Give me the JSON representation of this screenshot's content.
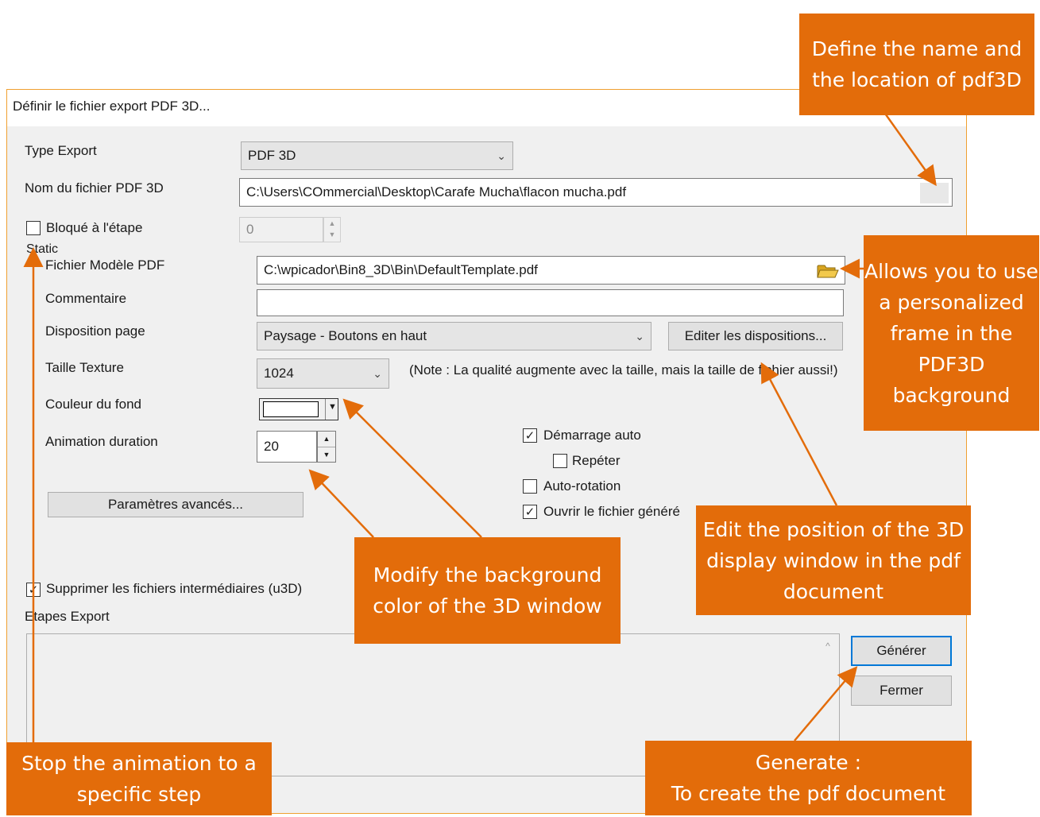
{
  "window": {
    "title": "Définir le fichier export PDF 3D..."
  },
  "form": {
    "type_export_label": "Type Export",
    "type_export_value": "PDF 3D",
    "nom_fichier_label": "Nom du fichier PDF 3D",
    "nom_fichier_value": "C:\\Users\\COmmercial\\Desktop\\Carafe Mucha\\flacon mucha.pdf",
    "bloque_label": "Bloqué à l'étape",
    "bloque_checked": false,
    "bloque_value": "0",
    "static_label": "Static",
    "modele_label": "Fichier Modèle PDF",
    "modele_value": "C:\\wpicador\\Bin8_3D\\Bin\\DefaultTemplate.pdf",
    "commentaire_label": "Commentaire",
    "commentaire_value": "",
    "disposition_label": "Disposition page",
    "disposition_value": "Paysage - Boutons en haut",
    "editer_button": "Editer les dispositions...",
    "texture_label": "Taille Texture",
    "texture_value": "1024",
    "texture_note": "(Note : La qualité augmente avec la taille, mais la taille de fichier aussi!)",
    "couleur_label": "Couleur du fond",
    "couleur_value": "#ffffff",
    "animation_label": "Animation duration",
    "animation_value": "20",
    "demarrage_label": "Démarrage auto",
    "demarrage_checked": true,
    "repeter_label": "Repéter",
    "repeter_checked": false,
    "autorotation_label": "Auto-rotation",
    "autorotation_checked": false,
    "ouvrir_label": "Ouvrir le fichier généré",
    "ouvrir_checked": true,
    "parametres_button": "Paramètres avancés...",
    "supprimer_label": "Supprimer les fichiers intermédiaires (u3D)",
    "supprimer_checked": true,
    "etapes_label": "Etapes Export",
    "generer_button": "Générer",
    "fermer_button": "Fermer"
  },
  "callouts": {
    "name_location": "Define the name and the location of pdf3D",
    "frame": "Allows you to use a personalized frame in the PDF3D background",
    "bg_color": "Modify the background color of the 3D window",
    "edit_position": "Edit the position of the 3D display window in the pdf document",
    "stop_animation": "Stop the animation to a specific step",
    "generate": "Generate :\nTo create the pdf document"
  },
  "colors": {
    "callout": "#e36c0a",
    "window_border": "#f0a030",
    "dialog_bg": "#f0f0f0"
  },
  "icons": {
    "folder": "folder-open-icon",
    "chevron": "chevron-down-icon"
  }
}
